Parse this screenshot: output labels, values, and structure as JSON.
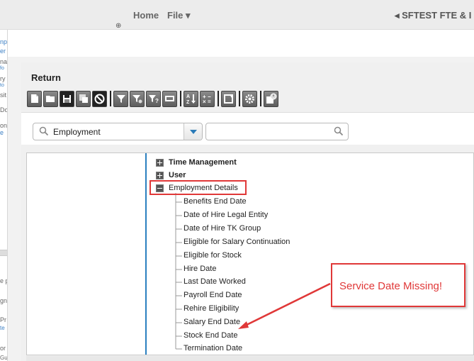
{
  "nav": {
    "home_label": "Home",
    "file_label": "File ▾",
    "right_label": "◂ SFTEST FTE & I"
  },
  "sidebar_fragments": [
    "np",
    "er",
    "na",
    "fo",
    "ry",
    "to",
    "sit",
    "Do",
    "on",
    "e",
    "e p",
    "gn",
    "Pr",
    "te",
    "or",
    "Gu"
  ],
  "dialog": {
    "title": "Return",
    "toolbar_icons": [
      "new-document-icon",
      "open-folder-icon",
      "save-icon",
      "save-as-icon",
      "cancel-icon",
      "filter-icon",
      "filter-settings-icon",
      "filter-help-icon",
      "date-icon",
      "sort-az-icon",
      "calculator-icon",
      "refresh-icon",
      "settings-icon",
      "schedule-icon"
    ]
  },
  "search": {
    "category_value": "Employment",
    "search_placeholder": ""
  },
  "tree": {
    "groups": [
      {
        "label": "Time Management",
        "expanded": false
      },
      {
        "label": "User",
        "expanded": false
      },
      {
        "label": "Employment Details",
        "expanded": true
      }
    ],
    "fields": [
      "Benefits End Date",
      "Date of Hire Legal Entity",
      "Date of Hire TK Group",
      "Eligible for Salary Continuation",
      "Eligible for Stock",
      "Hire Date",
      "Last Date Worked",
      "Payroll End Date",
      "Rehire Eligibility",
      "Salary End Date",
      "Stock End Date",
      "Termination Date"
    ]
  },
  "annotation": {
    "callout_text": "Service Date Missing!",
    "color": "#e03838"
  }
}
